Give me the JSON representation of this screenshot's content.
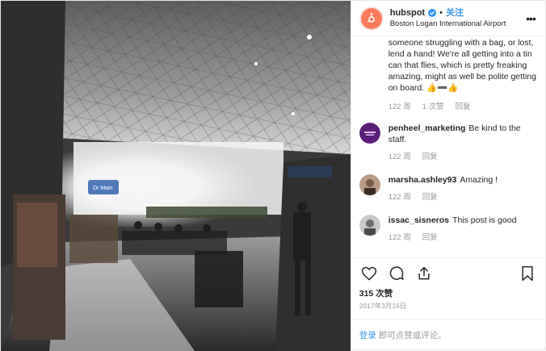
{
  "header": {
    "username": "hubspot",
    "follow_label": "关注",
    "location": "Boston Logan International Airport"
  },
  "caption": {
    "text": "someone struggling with a bag, or lost, lend a hand! We're all getting into a tin can that flies, which is pretty freaking amazing, might as well be polite getting on board. 👍➖👍",
    "time": "122 周",
    "likes": "1 次赞",
    "reply": "回复"
  },
  "comments": [
    {
      "user": "penheel_marketing",
      "text": "Be kind to the staff.",
      "time": "122 周",
      "reply": "回复"
    },
    {
      "user": "marsha.ashley93",
      "text": "Amazing !",
      "time": "122 周",
      "reply": "回复"
    },
    {
      "user": "issac_sisneros",
      "text": "This post is good",
      "time": "122 周",
      "reply": "回复"
    }
  ],
  "likes_count": "315 次赞",
  "date": "2017年3月16日",
  "login": {
    "link": "登录",
    "rest": "即可点赞或评论。"
  },
  "photo": {
    "sign_text": "Dr Main"
  },
  "colors": {
    "accent": "#3897f0",
    "brand": "#ff7a59"
  }
}
